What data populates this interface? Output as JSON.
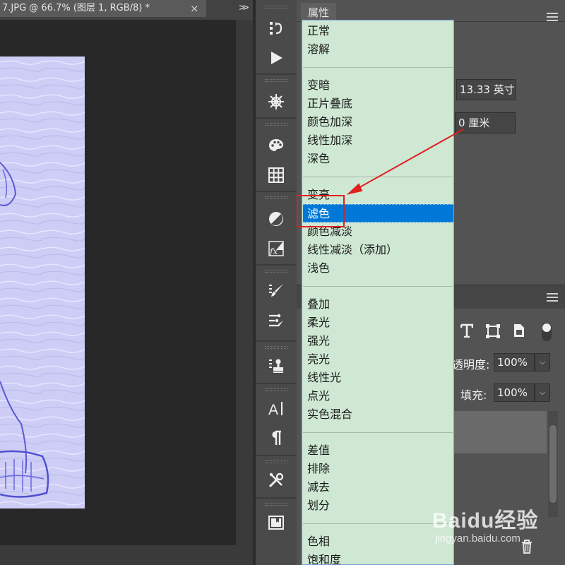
{
  "document_tab": {
    "title": "7.JPG @ 66.7% (图层 1, RGB/8) *",
    "close_glyph": "×",
    "overflow_glyph": ">>"
  },
  "tools": [
    {
      "icon": "history-icon"
    },
    {
      "icon": "play-icon"
    },
    {
      "icon": "navigator-icon"
    },
    {
      "icon": "color-palette-icon"
    },
    {
      "icon": "swatches-grid-icon"
    },
    {
      "icon": "adjustments-icon"
    },
    {
      "icon": "fx-styles-icon"
    },
    {
      "icon": "brush-presets-icon"
    },
    {
      "icon": "brush-settings-icon"
    },
    {
      "icon": "clone-source-icon"
    },
    {
      "icon": "character-icon"
    },
    {
      "icon": "paragraph-icon"
    },
    {
      "icon": "tool-presets-icon"
    },
    {
      "icon": "info-panel-icon"
    }
  ],
  "properties": {
    "tab_label": "属性",
    "width_value": "13.33 英寸",
    "offset_value": "0 厘米"
  },
  "layers": {
    "opacity_label": "透明度:",
    "opacity_value": "100%",
    "fill_label": "填充:",
    "fill_value": "100%",
    "tool_icons": [
      "text-layer-icon",
      "shape-layer-icon",
      "smart-object-icon",
      "filter-toggle-icon"
    ]
  },
  "blend_menu": {
    "groups": [
      [
        "正常",
        "溶解"
      ],
      [
        "变暗",
        "正片叠底",
        "颜色加深",
        "线性加深",
        "深色"
      ],
      [
        "变亮",
        "滤色",
        "颜色减淡",
        "线性减淡（添加）",
        "浅色"
      ],
      [
        "叠加",
        "柔光",
        "强光",
        "亮光",
        "线性光",
        "点光",
        "实色混合"
      ],
      [
        "差值",
        "排除",
        "减去",
        "划分"
      ],
      [
        "色相",
        "饱和度"
      ]
    ],
    "selected": "滤色"
  },
  "watermark": {
    "text": "Baidu经验",
    "sub": "jingyan.baidu.com"
  },
  "colors": {
    "menu_bg": "#cfe8d3",
    "selection": "#0078d7",
    "annotation": "#e02020",
    "canvas_image": "#cfcff6"
  }
}
